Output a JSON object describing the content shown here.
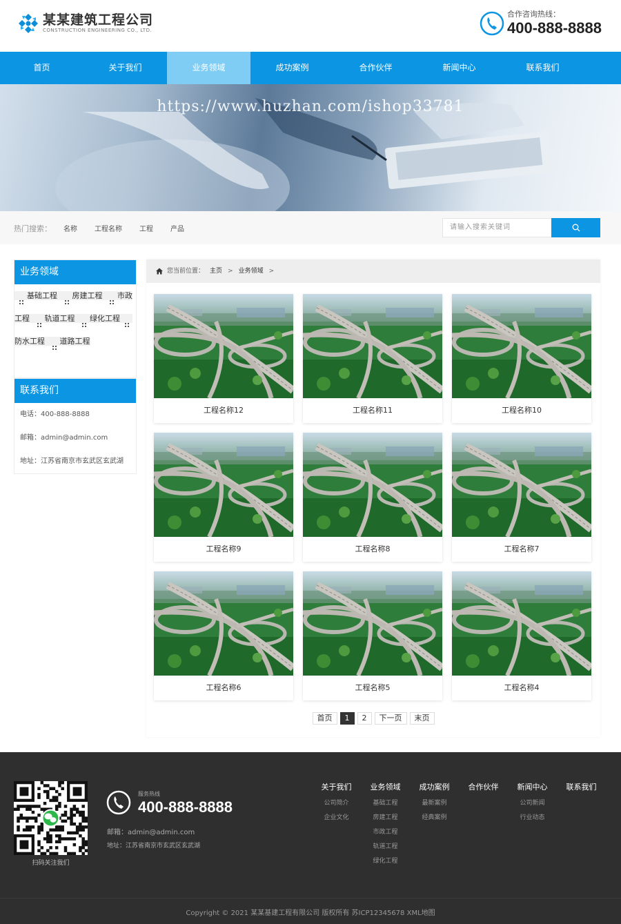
{
  "header": {
    "logo_cn": "某某建筑工程公司",
    "logo_en": "CONSTRUCTION ENGINEERING CO., LTD.",
    "hotline_label": "合作咨询热线：",
    "hotline_number": "400-888-8888"
  },
  "nav": {
    "items": [
      "首页",
      "关于我们",
      "业务领域",
      "成功案例",
      "合作伙伴",
      "新闻中心",
      "联系我们"
    ],
    "active_index": 2
  },
  "banner": {
    "watermark": "https://www.huzhan.com/ishop33781"
  },
  "search": {
    "hot_label": "热门搜索：",
    "hot_words": [
      "名称",
      "工程名称",
      "工程",
      "产品"
    ],
    "placeholder": "请输入搜索关键词"
  },
  "sidebar": {
    "category_title": "业务领域",
    "categories": [
      "基础工程",
      "房建工程",
      "市政工程",
      "轨道工程",
      "绿化工程",
      "防水工程",
      "道路工程"
    ],
    "contact_title": "联系我们",
    "contact": {
      "phone": "电话：400-888-8888",
      "email": "邮箱：admin@admin.com",
      "address": "地址：江苏省南京市玄武区玄武湖"
    }
  },
  "breadcrumb": {
    "prefix": "您当前位置：",
    "items": [
      "主页",
      "业务领域"
    ],
    "sep": ">"
  },
  "projects": [
    {
      "title": "工程名称12"
    },
    {
      "title": "工程名称11"
    },
    {
      "title": "工程名称10"
    },
    {
      "title": "工程名称9"
    },
    {
      "title": "工程名称8"
    },
    {
      "title": "工程名称7"
    },
    {
      "title": "工程名称6"
    },
    {
      "title": "工程名称5"
    },
    {
      "title": "工程名称4"
    }
  ],
  "pagination": {
    "first": "首页",
    "pages": [
      "1",
      "2"
    ],
    "current": "1",
    "next": "下一页",
    "last": "末页"
  },
  "footer": {
    "qr_caption": "扫码关注我们",
    "service_label": "服务热线",
    "phone": "400-888-8888",
    "email": "邮箱：admin@admin.com",
    "address": "地址：江苏省南京市玄武区玄武湖",
    "columns": [
      {
        "title": "关于我们",
        "links": [
          "公司简介",
          "企业文化"
        ]
      },
      {
        "title": "业务领域",
        "links": [
          "基础工程",
          "房建工程",
          "市政工程",
          "轨道工程",
          "绿化工程"
        ]
      },
      {
        "title": "成功案例",
        "links": [
          "最新案例",
          "经典案例"
        ]
      },
      {
        "title": "合作伙伴",
        "links": []
      },
      {
        "title": "新闻中心",
        "links": [
          "公司新闻",
          "行业动态"
        ]
      },
      {
        "title": "联系我们",
        "links": []
      }
    ],
    "copyright": "Copyright © 2021 某某基建工程有限公司 版权所有    苏ICP12345678 XML地图"
  },
  "colors": {
    "brand_blue": "#0c95e3",
    "nav_active": "#7fcdf4",
    "footer_bg": "#2f2f2f"
  },
  "icons": [
    "logo-icon",
    "phone-icon",
    "search-icon",
    "home-icon",
    "bullet-icon",
    "wechat-icon",
    "qr-code-icon"
  ]
}
